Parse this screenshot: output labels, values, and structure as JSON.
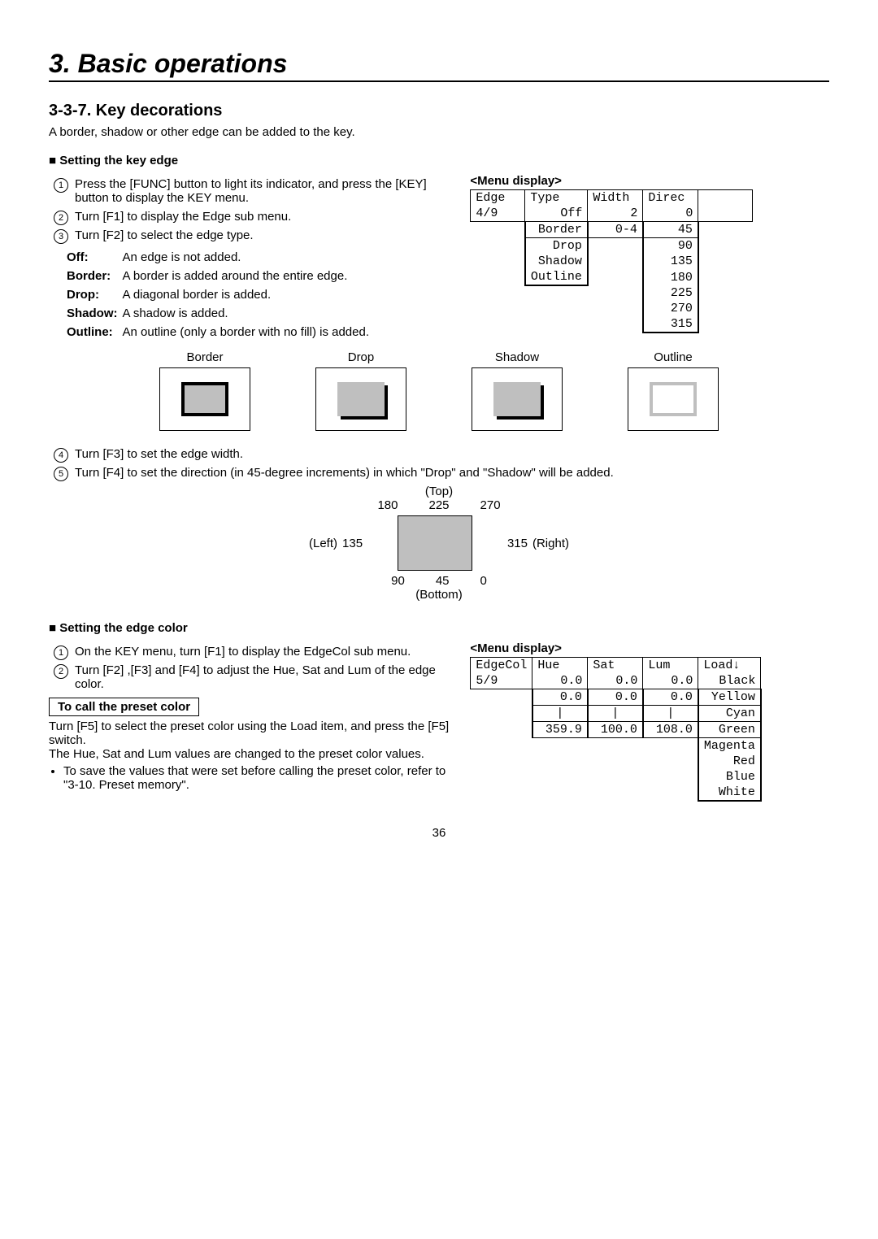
{
  "chapter": "3. Basic operations",
  "section": "3-3-7. Key decorations",
  "intro": "A border, shadow or other edge can be added to the key.",
  "edge": {
    "heading": "Setting the key edge",
    "step1": "Press the [FUNC] button to light its indicator, and press the [KEY] button to display the KEY menu.",
    "step2": "Turn [F1] to display the Edge sub menu.",
    "step3": "Turn [F2] to select the edge type.",
    "types": {
      "off_k": "Off:",
      "off_v": "An edge is not added.",
      "border_k": "Border:",
      "border_v": "A border is added around the entire edge.",
      "drop_k": "Drop:",
      "drop_v": "A diagonal border is added.",
      "shadow_k": "Shadow:",
      "shadow_v": "A shadow is added.",
      "outline_k": "Outline:",
      "outline_v": "An outline (only a border with no fill) is added."
    },
    "step4": "Turn [F3] to set the edge width.",
    "step5": "Turn [F4] to set the direction (in 45-degree increments) in which \"Drop\" and \"Shadow\" will be added."
  },
  "previews": {
    "border": "Border",
    "drop": "Drop",
    "shadow": "Shadow",
    "outline": "Outline"
  },
  "direction": {
    "top": "(Top)",
    "bottom": "(Bottom)",
    "left": "(Left)",
    "right": "(Right)",
    "d180": "180",
    "d225": "225",
    "d270": "270",
    "d135": "135",
    "d315": "315",
    "d90": "90",
    "d45": "45",
    "d0": "0"
  },
  "menu1_label": "<Menu display>",
  "menu1": {
    "h1": "Edge",
    "h2": "Type",
    "h3": "Width",
    "h4": "Direc",
    "v1": "4/9",
    "v2": "Off",
    "v3": "2",
    "v4": "0",
    "r2": "Border",
    "r3": "0-4",
    "r4": "45",
    "opts_type": [
      "Drop",
      "Shadow",
      "Outline"
    ],
    "opts_dir": [
      "90",
      "135",
      "180",
      "225",
      "270",
      "315"
    ]
  },
  "color": {
    "heading": "Setting the edge color",
    "step1": "On the KEY menu, turn [F1] to display the EdgeCol sub menu.",
    "step2": "Turn [F2] ,[F3] and [F4] to adjust the Hue, Sat and Lum of the edge color.",
    "preset_title": "To call the preset color",
    "preset1": "Turn [F5] to select the preset color using the Load item, and press the [F5] switch.",
    "preset2": "The Hue, Sat and Lum values are changed to the preset color values.",
    "preset3": "To save the values that were set before calling the preset color, refer to \"3-10. Preset memory\"."
  },
  "menu2_label": "<Menu display>",
  "menu2": {
    "h1": "EdgeCol",
    "h2": "Hue",
    "h3": "Sat",
    "h4": "Lum",
    "h5": "Load↓",
    "v1": "5/9",
    "v2": "0.0",
    "v3": "0.0",
    "v4": "0.0",
    "v5": "Black",
    "r2": "0.0",
    "r3": "0.0",
    "r4": "0.0",
    "r5": "Yellow",
    "m2": "|",
    "m3": "|",
    "m4": "|",
    "m5": "Cyan",
    "x2": "359.9",
    "x3": "100.0",
    "x4": "108.0",
    "x5": "Green",
    "opts": [
      "Magenta",
      "Red",
      "Blue",
      "White"
    ]
  },
  "page": "36"
}
